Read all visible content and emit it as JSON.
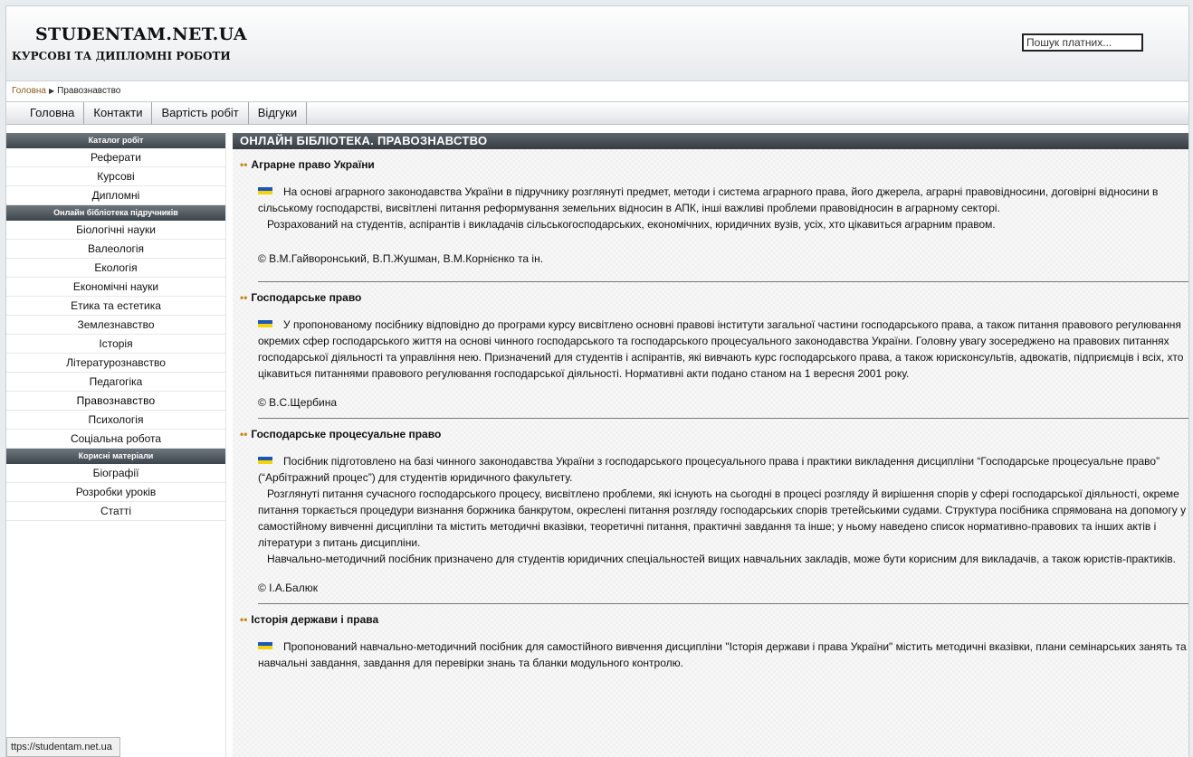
{
  "header": {
    "site_title": "STUDENTAM.NET.UA",
    "subtitle": "КУРСОВІ ТА ДИПЛОМНІ РОБОТИ",
    "search_value": "Пошук платних..."
  },
  "breadcrumb": {
    "home": "Головна",
    "separator": "▶",
    "current": "Правознавство"
  },
  "topnav": [
    "Головна",
    "Контакти",
    "Вартість робіт",
    "Відгуки"
  ],
  "sidebar": {
    "sections": [
      {
        "title": "Каталог робіт",
        "items": [
          "Реферати",
          "Курсові",
          "Дипломні"
        ]
      },
      {
        "title": "Онлайн бібліотека підручників",
        "items": [
          "Біологічні науки",
          "Валеологія",
          "Екологія",
          "Економічні науки",
          "Етика та естетика",
          "Землезнавство",
          "Історія",
          "Літературознавство",
          "Педагогіка",
          "Правознавство",
          "Психологія",
          "Соціальна робота"
        ]
      },
      {
        "title": "Корисні матеріали",
        "items": [
          "Біографії",
          "Розробки уроків",
          "Статті"
        ]
      }
    ]
  },
  "content": {
    "heading": "ОНЛАЙН БІБЛІОТЕКА. ПРАВОЗНАВСТВО",
    "entries": [
      {
        "title": "Аграрне право України",
        "paragraphs": [
          "На основі аграрного законодавства України в підручнику розглянуті предмет, методи і система аграрного права, його джерела, аграрні правовідносини, договірні відносини в сільському господарстві, висвітлені питання реформування земельних відносин в АПК, інші важливі проблеми правовідносин в аграрному секторі.",
          "Розрахований на студентів, аспірантів і викладачів сільськогосподарських, економічних, юридичних вузів, усіх, хто цікавиться аграрним правом."
        ],
        "author": "© В.М.Гайворонський, В.П.Жушман, В.М.Корнієнко та ін."
      },
      {
        "title": "Господарське право",
        "paragraphs": [
          "У пропонованому посібнику відповідно до програми курсу висвітлено основні правові інститути загальної частини господарського права, а також питання правового регулювання окремих сфер господарського життя на основі чинного господарського та господарського процесуального законодавства України. Головну увагу зосереджено на правових питаннях господарської діяльності та управління нею. Призначений для студентів і аспірантів, які вивчають курс господарського права, а також юрисконсультів, адвокатів, підприємців і всіх, хто цікавиться питаннями правового регулювання господарської діяльності. Нормативні акти подано станом на 1 вересня 2001 року."
        ],
        "author": "© В.С.Щербина"
      },
      {
        "title": "Господарське процесуальне право",
        "paragraphs": [
          "Посібник підготовлено на базі чинного законодавства України з господарського процесуального права і практики викладення дисципліни “Господарське процесуальне право” (“Арбітражний процес”) для студентів юридичного факультету.",
          "Розглянуті питання сучасного господарського процесу, висвітлено проблеми, які існують на сьогодні в процесі розгляду й вирішення спорів у сфері господарської діяльності, окреме питання торкається процедури визнання боржника банкрутом, окреслені питання розгляду господарських спорів третейськими судами. Структура посібника спрямована на допомогу у самостійному вивченні дисципліни та містить методичні вказівки, теоретичні питання, практичні завдання та інше; у ньому наведено список нормативно-правових та інших актів і літератури з питань дисципліни.",
          "Навчально-методичний посібник призначено для студентів юридичних спеціальностей вищих навчальних закладів, може бути корисним для викладачів, а також юристів-практиків."
        ],
        "author": "© І.А.Балюк"
      },
      {
        "title": "Історія держави і права",
        "paragraphs": [
          "Пропонований навчально-методичний посібник для самостійного вивчення дисципліни \"Історія держави і права України\" містить методичні вказівки, плани семінарських занять та навчальні завдання, завдання для перевірки знань та бланки модульного контролю."
        ],
        "author": ""
      }
    ]
  },
  "status_bar": "ttps://studentam.net.ua",
  "colors": {
    "accent_dots": "#c48a1b",
    "flag_blue": "#1c57b6",
    "flag_yellow": "#f4d20c",
    "header_dark": "#3d454c"
  }
}
